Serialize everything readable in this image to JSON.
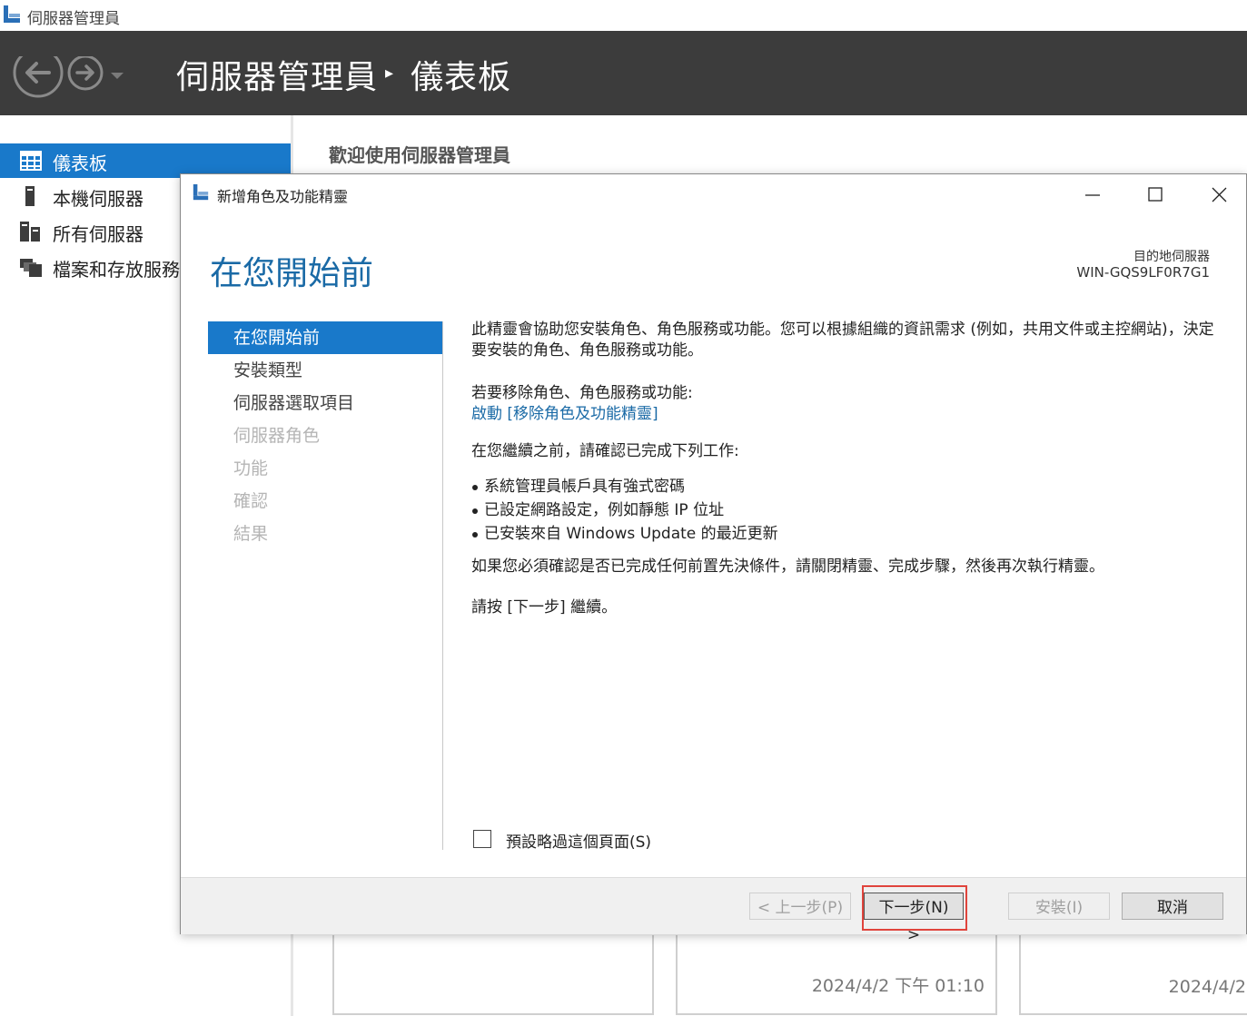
{
  "window": {
    "title": "伺服器管理員"
  },
  "header": {
    "app_name": "伺服器管理員",
    "separator": "▸",
    "current_page": "儀表板"
  },
  "sidebar": {
    "items": [
      {
        "label": "儀表板",
        "icon": "dashboard-icon",
        "active": true
      },
      {
        "label": "本機伺服器",
        "icon": "server-icon",
        "active": false
      },
      {
        "label": "所有伺服器",
        "icon": "servers-icon",
        "active": false
      },
      {
        "label": "檔案和存放服務",
        "icon": "file-storage-icon",
        "active": false
      }
    ]
  },
  "main": {
    "welcome": "歡迎使用伺服器管理員",
    "tiles": [
      {
        "timestamp": ""
      },
      {
        "timestamp": "2024/4/2 下午 01:10"
      },
      {
        "timestamp": "2024/4/2"
      }
    ]
  },
  "wizard": {
    "title": "新增角色及功能精靈",
    "heading": "在您開始前",
    "destination_label": "目的地伺服器",
    "destination_value": "WIN-GQS9LF0R7G1",
    "steps": [
      {
        "label": "在您開始前",
        "state": "active"
      },
      {
        "label": "安裝類型",
        "state": "enabled"
      },
      {
        "label": "伺服器選取項目",
        "state": "enabled"
      },
      {
        "label": "伺服器角色",
        "state": "disabled"
      },
      {
        "label": "功能",
        "state": "disabled"
      },
      {
        "label": "確認",
        "state": "disabled"
      },
      {
        "label": "結果",
        "state": "disabled"
      }
    ],
    "content": {
      "intro": "此精靈會協助您安裝角色、角色服務或功能。您可以根據組織的資訊需求 (例如，共用文件或主控網站)，決定要安裝的角色、角色服務或功能。",
      "remove_prompt": "若要移除角色、角色服務或功能:",
      "remove_link": "啟動 [移除角色及功能精靈]",
      "confirm_prompt": "在您繼續之前，請確認已完成下列工作:",
      "bullets": [
        "系統管理員帳戶具有強式密碼",
        "已設定網路設定，例如靜態 IP 位址",
        "已安裝來自 Windows Update 的最近更新"
      ],
      "prereq_note": "如果您必須確認是否已完成任何前置先決條件，請關閉精靈、完成步驟，然後再次執行精靈。",
      "continue_note": "請按 [下一步] 繼續。"
    },
    "skip_checkbox": {
      "label": "預設略過這個頁面(S)",
      "checked": false
    },
    "buttons": {
      "previous": "< 上一步(P)",
      "next": "下一步(N) >",
      "install": "安裝(I)",
      "cancel": "取消"
    },
    "highlight_color": "#e0443c",
    "accent_color": "#1979ca"
  }
}
